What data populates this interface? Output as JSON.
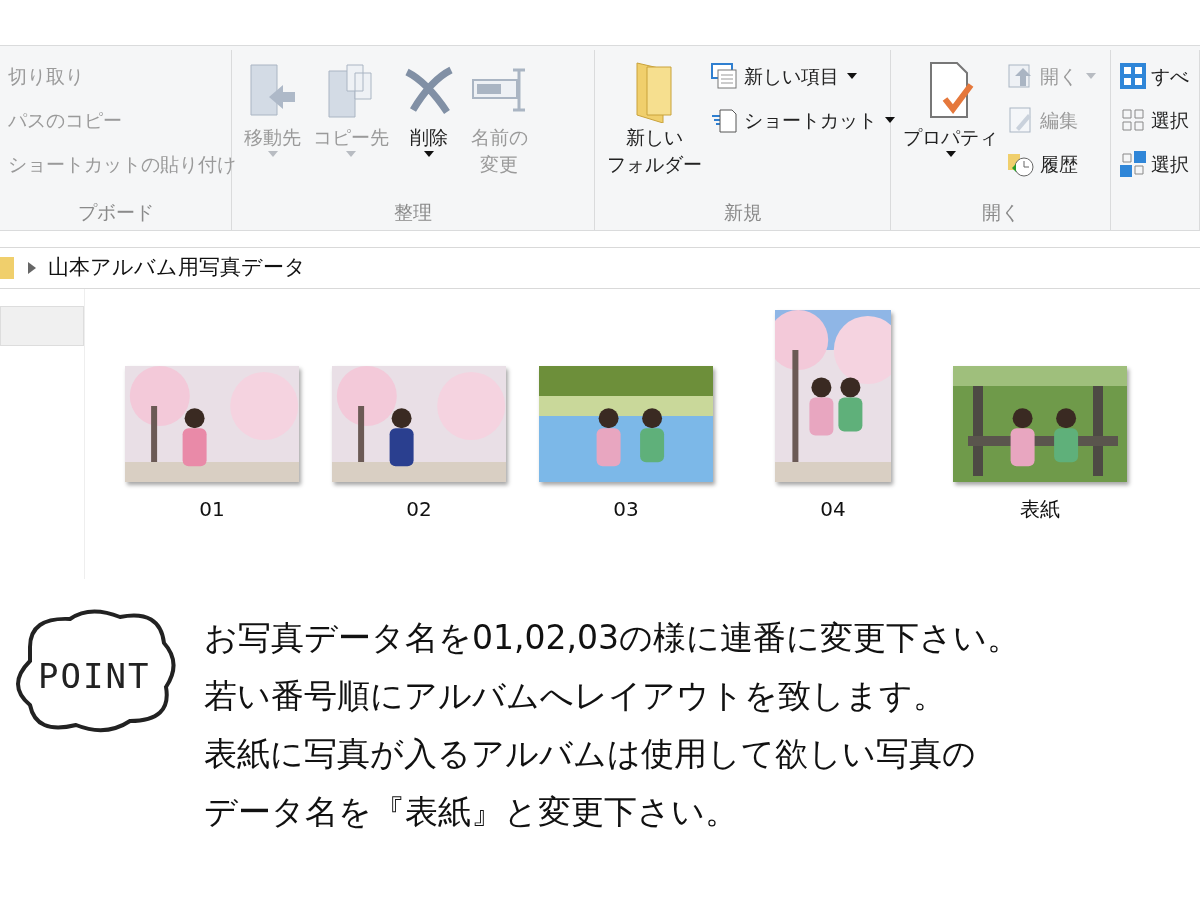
{
  "ribbon": {
    "groups": [
      {
        "label": "プボード",
        "items": [
          {
            "kind": "small",
            "label": "切り取り",
            "disabled": true
          },
          {
            "kind": "small",
            "label": "パスのコピー",
            "disabled": true
          },
          {
            "kind": "small",
            "label": "ショートカットの貼り付け",
            "disabled": true
          }
        ]
      },
      {
        "label": "整理",
        "items": [
          {
            "kind": "large",
            "label": "移動先",
            "disabled": true,
            "dropdown": true
          },
          {
            "kind": "large",
            "label": "コピー先",
            "disabled": true,
            "dropdown": true
          },
          {
            "kind": "large",
            "label": "削除",
            "disabled": false,
            "dropdown": true
          },
          {
            "kind": "large",
            "lines": [
              "名前の",
              "変更"
            ],
            "disabled": true,
            "dropdown": false
          }
        ]
      },
      {
        "label": "新規",
        "items": [
          {
            "kind": "large",
            "lines": [
              "新しい",
              "フォルダー"
            ],
            "disabled": false,
            "dropdown": false
          },
          {
            "kind": "small",
            "label": "新しい項目",
            "disabled": false,
            "dropdown": true
          },
          {
            "kind": "small",
            "label": "ショートカット",
            "disabled": false,
            "dropdown": true
          }
        ]
      },
      {
        "label": "開く",
        "items": [
          {
            "kind": "large",
            "label": "プロパティ",
            "disabled": false,
            "dropdown": true
          },
          {
            "kind": "small",
            "label": "開く",
            "disabled": true,
            "dropdown": true
          },
          {
            "kind": "small",
            "label": "編集",
            "disabled": true,
            "dropdown": false
          },
          {
            "kind": "small",
            "label": "履歴",
            "disabled": false,
            "dropdown": false
          }
        ]
      },
      {
        "items": [
          {
            "kind": "small",
            "label": "すべ",
            "disabled": false
          },
          {
            "kind": "small",
            "label": "選択",
            "disabled": false
          },
          {
            "kind": "small",
            "label": "選択",
            "disabled": false
          }
        ]
      }
    ]
  },
  "address_bar": {
    "path": "山本アルバム用写真データ"
  },
  "files": [
    {
      "name": "01",
      "kind": "picture"
    },
    {
      "name": "02",
      "kind": "picture"
    },
    {
      "name": "03",
      "kind": "picture"
    },
    {
      "name": "04",
      "kind": "picture"
    },
    {
      "name": "表紙",
      "kind": "picture"
    }
  ],
  "point": {
    "badge": "POINT",
    "lines": [
      "お写真データ名を01,02,03の様に連番に変更下さい。",
      "若い番号順にアルバムへレイアウトを致します。",
      "表紙に写真が入るアルバムは使用して欲しい写真の",
      "データ名を『表紙』と変更下さい。"
    ]
  }
}
